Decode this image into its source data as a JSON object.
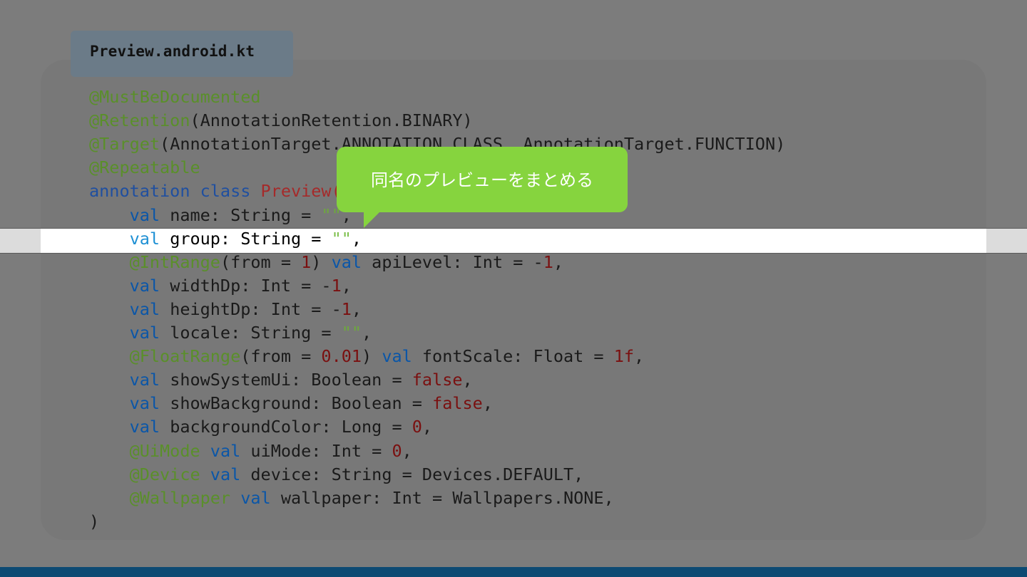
{
  "file_tab": {
    "label": "Preview.android.kt"
  },
  "tooltip": {
    "text": "同名のプレビューをまとめる"
  },
  "highlighted_line_index": 6,
  "code_lines": [
    [
      {
        "t": "@MustBeDocumented",
        "c": "ann"
      }
    ],
    [
      {
        "t": "@Retention",
        "c": "ann"
      },
      {
        "t": "(AnnotationRetention.BINARY)",
        "c": ""
      }
    ],
    [
      {
        "t": "@Target",
        "c": "ann"
      },
      {
        "t": "(AnnotationTarget.ANNOTATION_CLASS, AnnotationTarget.FUNCTION)",
        "c": ""
      }
    ],
    [
      {
        "t": "@Repeatable",
        "c": "ann"
      }
    ],
    [
      {
        "t": "annotation",
        "c": "kw"
      },
      {
        "t": " ",
        "c": ""
      },
      {
        "t": "class",
        "c": "kw"
      },
      {
        "t": " ",
        "c": ""
      },
      {
        "t": "Preview(",
        "c": "cls"
      }
    ],
    [
      {
        "t": "    ",
        "c": ""
      },
      {
        "t": "val",
        "c": "kwv"
      },
      {
        "t": " name: String = ",
        "c": ""
      },
      {
        "t": "\"\"",
        "c": "str"
      },
      {
        "t": ",",
        "c": ""
      }
    ],
    [
      {
        "t": "    ",
        "c": ""
      },
      {
        "t": "val",
        "c": "kwv"
      },
      {
        "t": " group: String = ",
        "c": ""
      },
      {
        "t": "\"\"",
        "c": "str"
      },
      {
        "t": ",",
        "c": ""
      }
    ],
    [
      {
        "t": "    ",
        "c": ""
      },
      {
        "t": "@IntRange",
        "c": "ann"
      },
      {
        "t": "(from = ",
        "c": ""
      },
      {
        "t": "1",
        "c": "num"
      },
      {
        "t": ") ",
        "c": ""
      },
      {
        "t": "val",
        "c": "kwv"
      },
      {
        "t": " apiLevel: Int = -",
        "c": ""
      },
      {
        "t": "1",
        "c": "num"
      },
      {
        "t": ",",
        "c": ""
      }
    ],
    [
      {
        "t": "    ",
        "c": ""
      },
      {
        "t": "val",
        "c": "kwv"
      },
      {
        "t": " widthDp: Int = -",
        "c": ""
      },
      {
        "t": "1",
        "c": "num"
      },
      {
        "t": ",",
        "c": ""
      }
    ],
    [
      {
        "t": "    ",
        "c": ""
      },
      {
        "t": "val",
        "c": "kwv"
      },
      {
        "t": " heightDp: Int = -",
        "c": ""
      },
      {
        "t": "1",
        "c": "num"
      },
      {
        "t": ",",
        "c": ""
      }
    ],
    [
      {
        "t": "    ",
        "c": ""
      },
      {
        "t": "val",
        "c": "kwv"
      },
      {
        "t": " locale: String = ",
        "c": ""
      },
      {
        "t": "\"\"",
        "c": "str"
      },
      {
        "t": ",",
        "c": ""
      }
    ],
    [
      {
        "t": "    ",
        "c": ""
      },
      {
        "t": "@FloatRange",
        "c": "ann"
      },
      {
        "t": "(from = ",
        "c": ""
      },
      {
        "t": "0.01",
        "c": "num"
      },
      {
        "t": ") ",
        "c": ""
      },
      {
        "t": "val",
        "c": "kwv"
      },
      {
        "t": " fontScale: Float = ",
        "c": ""
      },
      {
        "t": "1f",
        "c": "num"
      },
      {
        "t": ",",
        "c": ""
      }
    ],
    [
      {
        "t": "    ",
        "c": ""
      },
      {
        "t": "val",
        "c": "kwv"
      },
      {
        "t": " showSystemUi: Boolean = ",
        "c": ""
      },
      {
        "t": "false",
        "c": "num"
      },
      {
        "t": ",",
        "c": ""
      }
    ],
    [
      {
        "t": "    ",
        "c": ""
      },
      {
        "t": "val",
        "c": "kwv"
      },
      {
        "t": " showBackground: Boolean = ",
        "c": ""
      },
      {
        "t": "false",
        "c": "num"
      },
      {
        "t": ",",
        "c": ""
      }
    ],
    [
      {
        "t": "    ",
        "c": ""
      },
      {
        "t": "val",
        "c": "kwv"
      },
      {
        "t": " backgroundColor: Long = ",
        "c": ""
      },
      {
        "t": "0",
        "c": "num"
      },
      {
        "t": ",",
        "c": ""
      }
    ],
    [
      {
        "t": "    ",
        "c": ""
      },
      {
        "t": "@UiMode",
        "c": "ann"
      },
      {
        "t": " ",
        "c": ""
      },
      {
        "t": "val",
        "c": "kwv"
      },
      {
        "t": " uiMode: Int = ",
        "c": ""
      },
      {
        "t": "0",
        "c": "num"
      },
      {
        "t": ",",
        "c": ""
      }
    ],
    [
      {
        "t": "    ",
        "c": ""
      },
      {
        "t": "@Device",
        "c": "ann"
      },
      {
        "t": " ",
        "c": ""
      },
      {
        "t": "val",
        "c": "kwv"
      },
      {
        "t": " device: String = Devices.DEFAULT,",
        "c": ""
      }
    ],
    [
      {
        "t": "    ",
        "c": ""
      },
      {
        "t": "@Wallpaper",
        "c": "ann"
      },
      {
        "t": " ",
        "c": ""
      },
      {
        "t": "val",
        "c": "kwv"
      },
      {
        "t": " wallpaper: Int = Wallpapers.NONE,",
        "c": ""
      }
    ],
    [
      {
        "t": ")",
        "c": ""
      }
    ]
  ]
}
